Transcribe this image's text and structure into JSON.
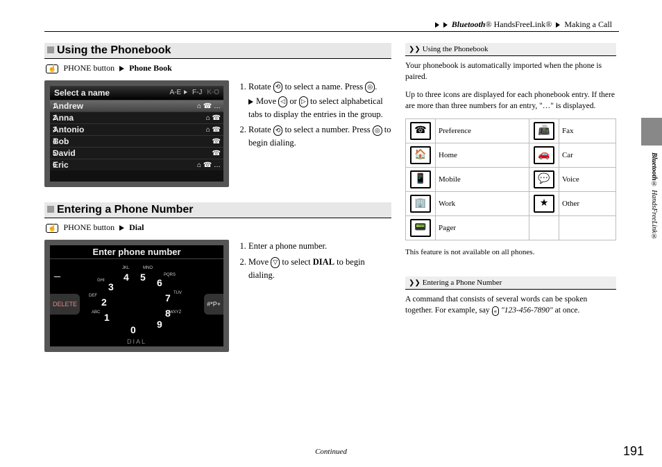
{
  "breadcrumb": {
    "part1_bold_italic": "Bluetooth",
    "part1_reg": "® HandsFreeLink®",
    "part2": "Making a Call"
  },
  "sections": {
    "phonebook": {
      "title": "Using the Phonebook",
      "nav_prefix": "PHONE button",
      "nav_dest": "Phone Book",
      "screen_title": "Select a name",
      "tabs": [
        "A-E",
        "F-J",
        "K-O"
      ],
      "names": [
        "Andrew",
        "Anna",
        "Antonio",
        "Bob",
        "David",
        "Eric"
      ],
      "step1_a": "Rotate ",
      "step1_b": " to select a name. Press ",
      "step1_c": ".",
      "sub_a": "Move ",
      "sub_b": " or ",
      "sub_c": " to select alphabetical tabs to display the entries in the group.",
      "step2_a": "Rotate ",
      "step2_b": " to select a number. Press ",
      "step2_c": " to begin dialing."
    },
    "dial": {
      "title": "Entering a Phone Number",
      "nav_prefix": "PHONE button",
      "nav_dest": "Dial",
      "screen_title": "Enter phone number",
      "delete": "DELETE",
      "pound": "#*P+",
      "dial_label": "DIAL",
      "digits": [
        "4",
        "5",
        "6",
        "3",
        "7",
        "2",
        "8",
        "1",
        "9",
        "0"
      ],
      "letters": [
        "JKL",
        "MNO",
        "GHI",
        "PQRS",
        "DEF",
        "TUV",
        "ABC",
        "WXYZ"
      ],
      "step1": "Enter a phone number.",
      "step2_a": "Move ",
      "step2_b": " to select ",
      "step2_bold": "DIAL",
      "step2_c": " to begin dialing."
    }
  },
  "sidebar": {
    "h1": "Using the Phonebook",
    "p1": "Your phonebook is automatically imported when the phone is paired.",
    "p2": "Up to three icons are displayed for each phonebook entry. If there are more than three numbers for an entry, \"…\" is displayed.",
    "legend": [
      {
        "icon": "☎",
        "label": "Preference"
      },
      {
        "icon": "📠",
        "label": "Fax"
      },
      {
        "icon": "🏠",
        "label": "Home"
      },
      {
        "icon": "🚗",
        "label": "Car"
      },
      {
        "icon": "📱",
        "label": "Mobile"
      },
      {
        "icon": "💬",
        "label": "Voice"
      },
      {
        "icon": "🏢",
        "label": "Work"
      },
      {
        "icon": "★",
        "label": "Other"
      },
      {
        "icon": "📟",
        "label": "Pager"
      },
      {
        "icon": "",
        "label": ""
      }
    ],
    "p3": "This feature is not available on all phones.",
    "h2": "Entering a Phone Number",
    "p4_a": "A command that consists of several words can be spoken together. For example, say ",
    "p4_quote": "\"123-456-7890\"",
    "p4_b": " at once."
  },
  "vtext_ital": "Bluetooth",
  "vtext_rest": "® HandsFreeLink®",
  "continued": "Continued",
  "pagenum": "191"
}
